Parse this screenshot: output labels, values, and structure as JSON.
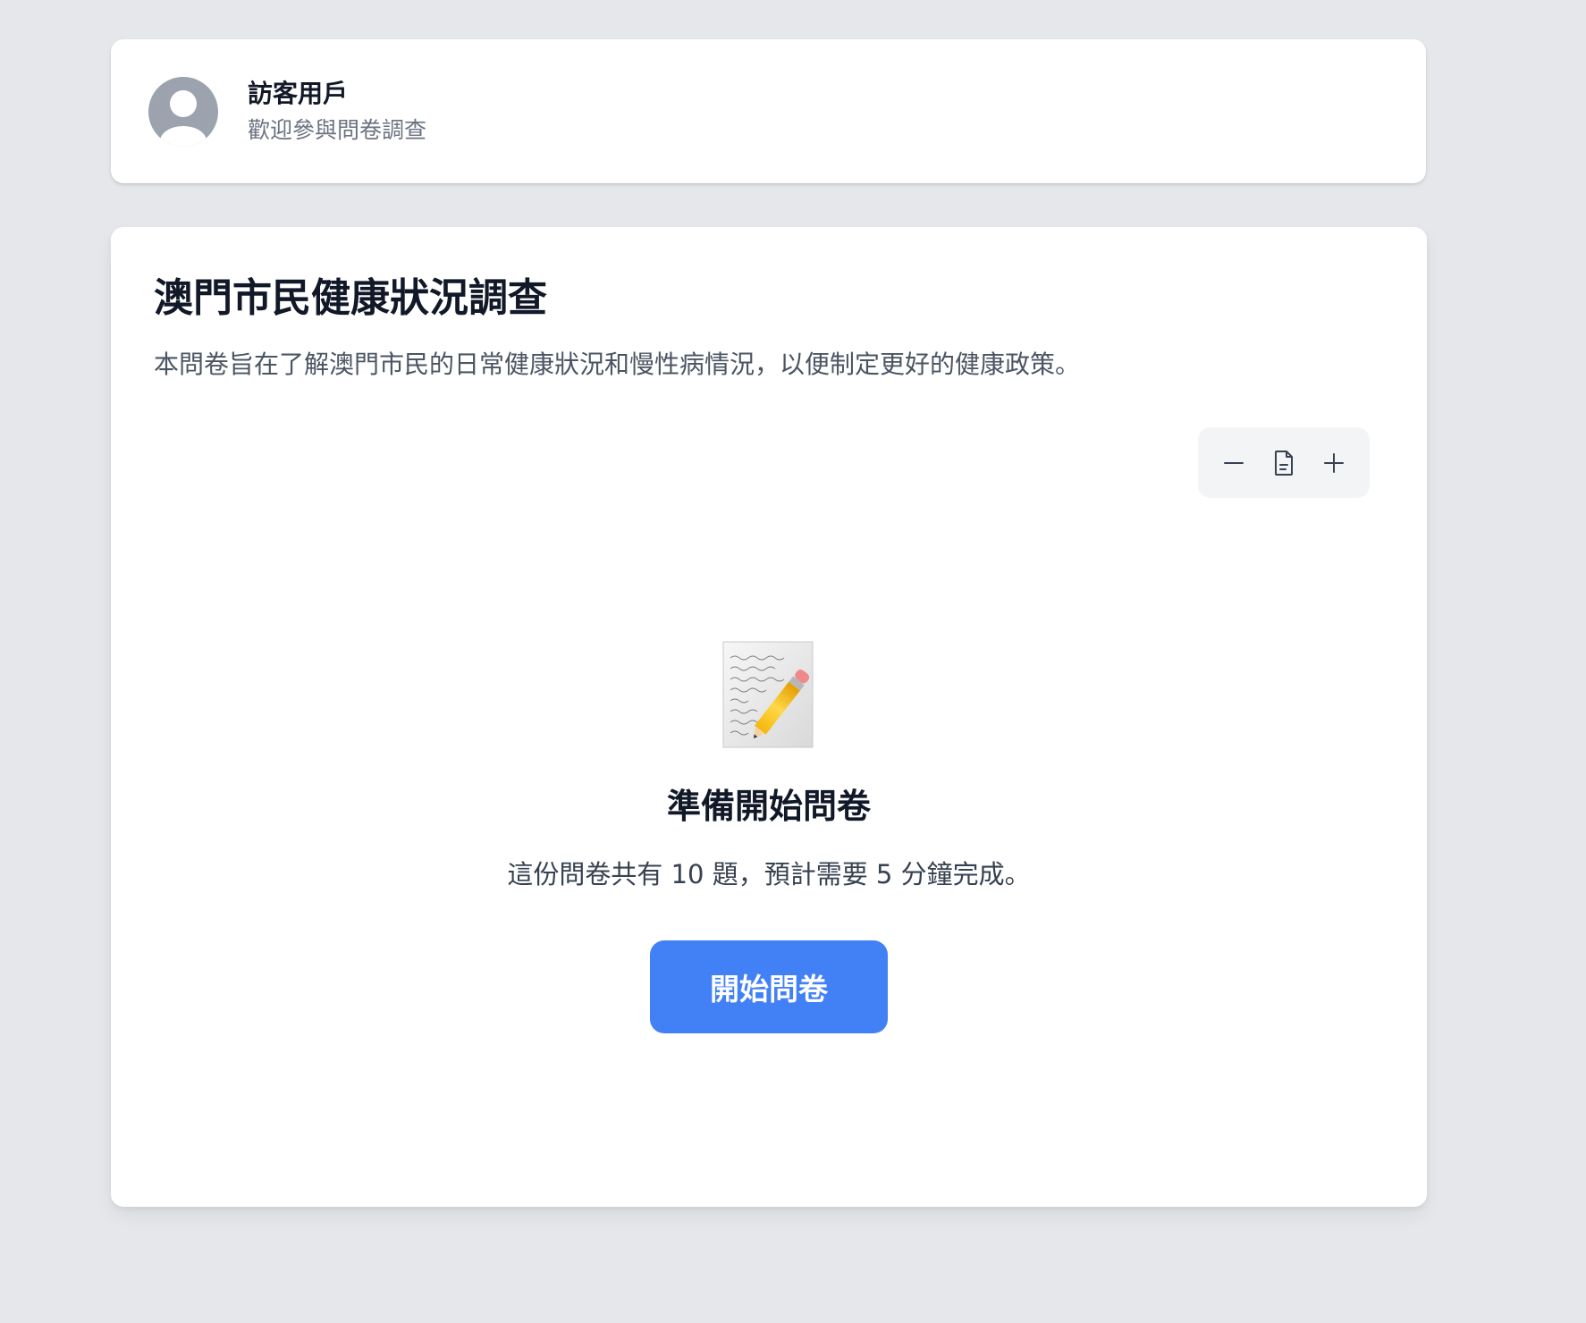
{
  "user": {
    "name": "訪客用戶",
    "subtitle": "歡迎參與問卷調查"
  },
  "survey": {
    "title": "澳門市民健康狀況調查",
    "description": "本問卷旨在了解澳門市民的日常健康狀況和慢性病情況，以便制定更好的健康政策。"
  },
  "zoom_controls": {
    "icons": [
      "minus-icon",
      "document-icon",
      "plus-icon"
    ]
  },
  "intro": {
    "icon": "memo-icon",
    "title": "準備開始問卷",
    "description": "這份問卷共有 10 題，預計需要 5 分鐘完成。",
    "start_label": "開始問卷"
  },
  "colors": {
    "background": "#e5e7eb",
    "primary": "#4280f6",
    "avatar": "#9ca3af"
  }
}
